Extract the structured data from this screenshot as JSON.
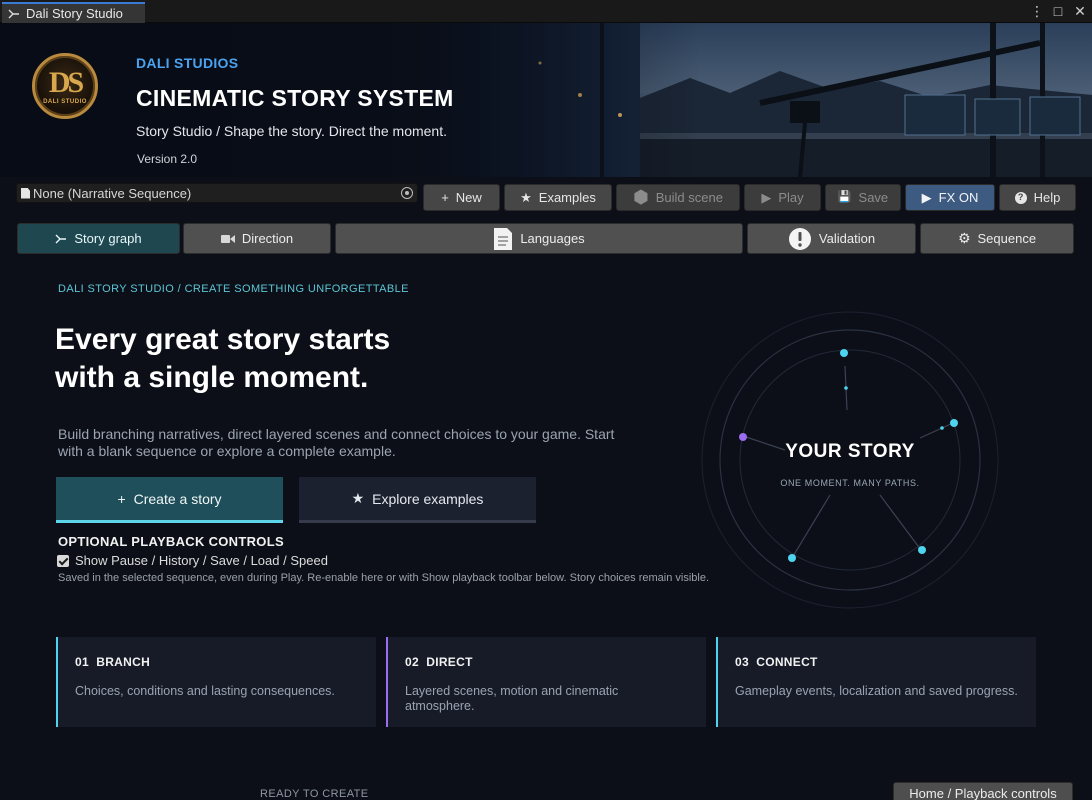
{
  "window": {
    "tab_title": "Dali Story Studio",
    "controls": [
      "⋮",
      "□",
      "✕"
    ]
  },
  "hero": {
    "logo_monogram": "DS",
    "logo_text": "DALI STUDIO",
    "brand": "DALI STUDIOS",
    "title": "CINEMATIC STORY SYSTEM",
    "subtitle": "Story Studio / Shape the story. Direct the moment.",
    "version": "Version 2.0"
  },
  "toolbar": {
    "sequence_value": "None (Narrative Sequence)",
    "buttons": [
      {
        "icon": "+",
        "label": "New",
        "enabled": true
      },
      {
        "icon": "★",
        "label": "Examples",
        "enabled": true
      },
      {
        "icon": "⬢",
        "label": "Build scene",
        "enabled": false
      },
      {
        "icon": "▶",
        "label": "Play",
        "enabled": false
      },
      {
        "icon": "💾",
        "label": "Save",
        "enabled": false
      },
      {
        "icon": "▶",
        "label": "FX ON",
        "enabled": true
      },
      {
        "icon": "?",
        "label": "Help",
        "enabled": true
      }
    ]
  },
  "tabs": [
    {
      "label": "Story graph",
      "active": true
    },
    {
      "label": "Direction",
      "active": false
    },
    {
      "label": "Languages",
      "active": false
    },
    {
      "label": "Validation",
      "active": false
    },
    {
      "label": "Sequence",
      "active": false
    }
  ],
  "main": {
    "breadcrumb": "DALI STORY STUDIO  /  CREATE SOMETHING UNFORGETTABLE",
    "headline_line1": "Every great story starts",
    "headline_line2": "with a single moment.",
    "lede": "Build branching narratives, direct layered scenes and connect choices to your game. Start with a blank sequence or explore a complete example.",
    "primary_cta": "Create a story",
    "secondary_cta": "Explore examples",
    "options_title": "OPTIONAL PLAYBACK CONTROLS",
    "options_checkbox": "Show Pause / History / Save / Load / Speed",
    "options_checked": true,
    "options_note": "Saved in the selected sequence, even during Play. Re-enable here or with Show playback toolbar below. Story choices remain visible."
  },
  "story_graphic": {
    "title": "YOUR STORY",
    "subtitle": "ONE MOMENT. MANY PATHS.",
    "node_color": "#4fd4ef",
    "accent_node_color": "#9b6cf0"
  },
  "cards": [
    {
      "number": "01",
      "title": "BRANCH",
      "desc": "Choices, conditions and lasting consequences.",
      "accent": "#4fd4ef"
    },
    {
      "number": "02",
      "title": "DIRECT",
      "desc": "Layered scenes, motion and cinematic atmosphere.",
      "accent": "#9b6cf0"
    },
    {
      "number": "03",
      "title": "CONNECT",
      "desc": "Gameplay events, localization and saved progress.",
      "accent": "#4fd4ef"
    }
  ],
  "footer": {
    "status": "READY TO CREATE",
    "home_button": "Home / Playback controls"
  }
}
